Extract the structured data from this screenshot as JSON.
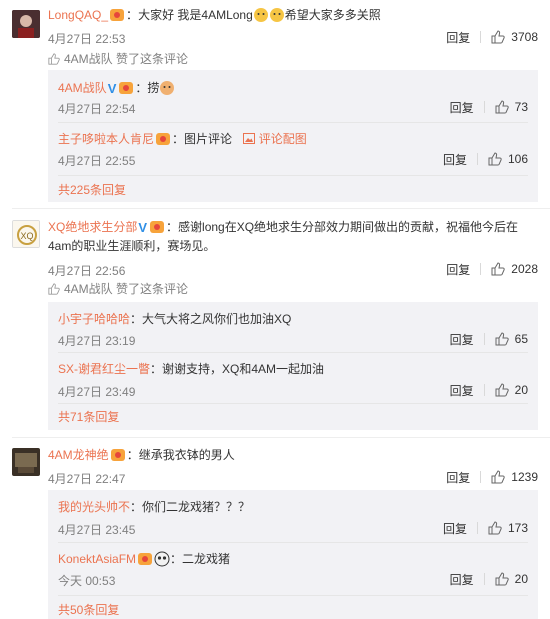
{
  "comments": [
    {
      "username": "LongQAQ_",
      "text": "大家好 我是4AMLong",
      "text_after": "希望大家多多关照",
      "time": "4月27日 22:53",
      "reply_label": "回复",
      "likes": "3708",
      "liked_by": "4AM战队 赞了这条评论",
      "replies": [
        {
          "username": "4AM战队",
          "text": "捞",
          "time": "4月27日 22:54",
          "reply_label": "回复",
          "likes": "73"
        },
        {
          "username": "主子哆啦本人肯尼",
          "text": "图片评论",
          "pic_link": "评论配图",
          "time": "4月27日 22:55",
          "reply_label": "回复",
          "likes": "106"
        }
      ],
      "more": "共225条回复"
    },
    {
      "username": "XQ绝地求生分部",
      "text": "感谢long在XQ绝地求生分部效力期间做出的贡献，祝福他今后在4am的职业生涯顺利，赛场见。",
      "time": "4月27日 22:56",
      "reply_label": "回复",
      "likes": "2028",
      "liked_by": "4AM战队 赞了这条评论",
      "replies": [
        {
          "username": "小宇子哈哈哈",
          "text": "大气大将之风你们也加油XQ",
          "time": "4月27日 23:19",
          "reply_label": "回复",
          "likes": "65"
        },
        {
          "username": "SX-谢君红尘一瞥",
          "text": "谢谢支持，XQ和4AM一起加油",
          "time": "4月27日 23:49",
          "reply_label": "回复",
          "likes": "20"
        }
      ],
      "more": "共71条回复"
    },
    {
      "username": "4AM龙神绝",
      "text": "继承我衣钵的男人",
      "time": "4月27日 22:47",
      "reply_label": "回复",
      "likes": "1239",
      "replies": [
        {
          "username": "我的光头帅不",
          "text": "你们二龙戏猪？？？",
          "time": "4月27日 23:45",
          "reply_label": "回复",
          "likes": "173"
        },
        {
          "username": "KonektAsiaFM",
          "text": "二龙戏猪",
          "time": "今天 00:53",
          "reply_label": "回复",
          "likes": "20"
        }
      ],
      "more": "共50条回复"
    }
  ],
  "colors": {
    "username": "#eb7350",
    "sub_bg": "#f2f2f5",
    "meta": "#808080",
    "verified": "#2f8fe6"
  },
  "icons": [
    "thumbs-up-icon",
    "vip-badge-icon",
    "verified-v-icon",
    "picture-icon",
    "emoji-icon"
  ]
}
